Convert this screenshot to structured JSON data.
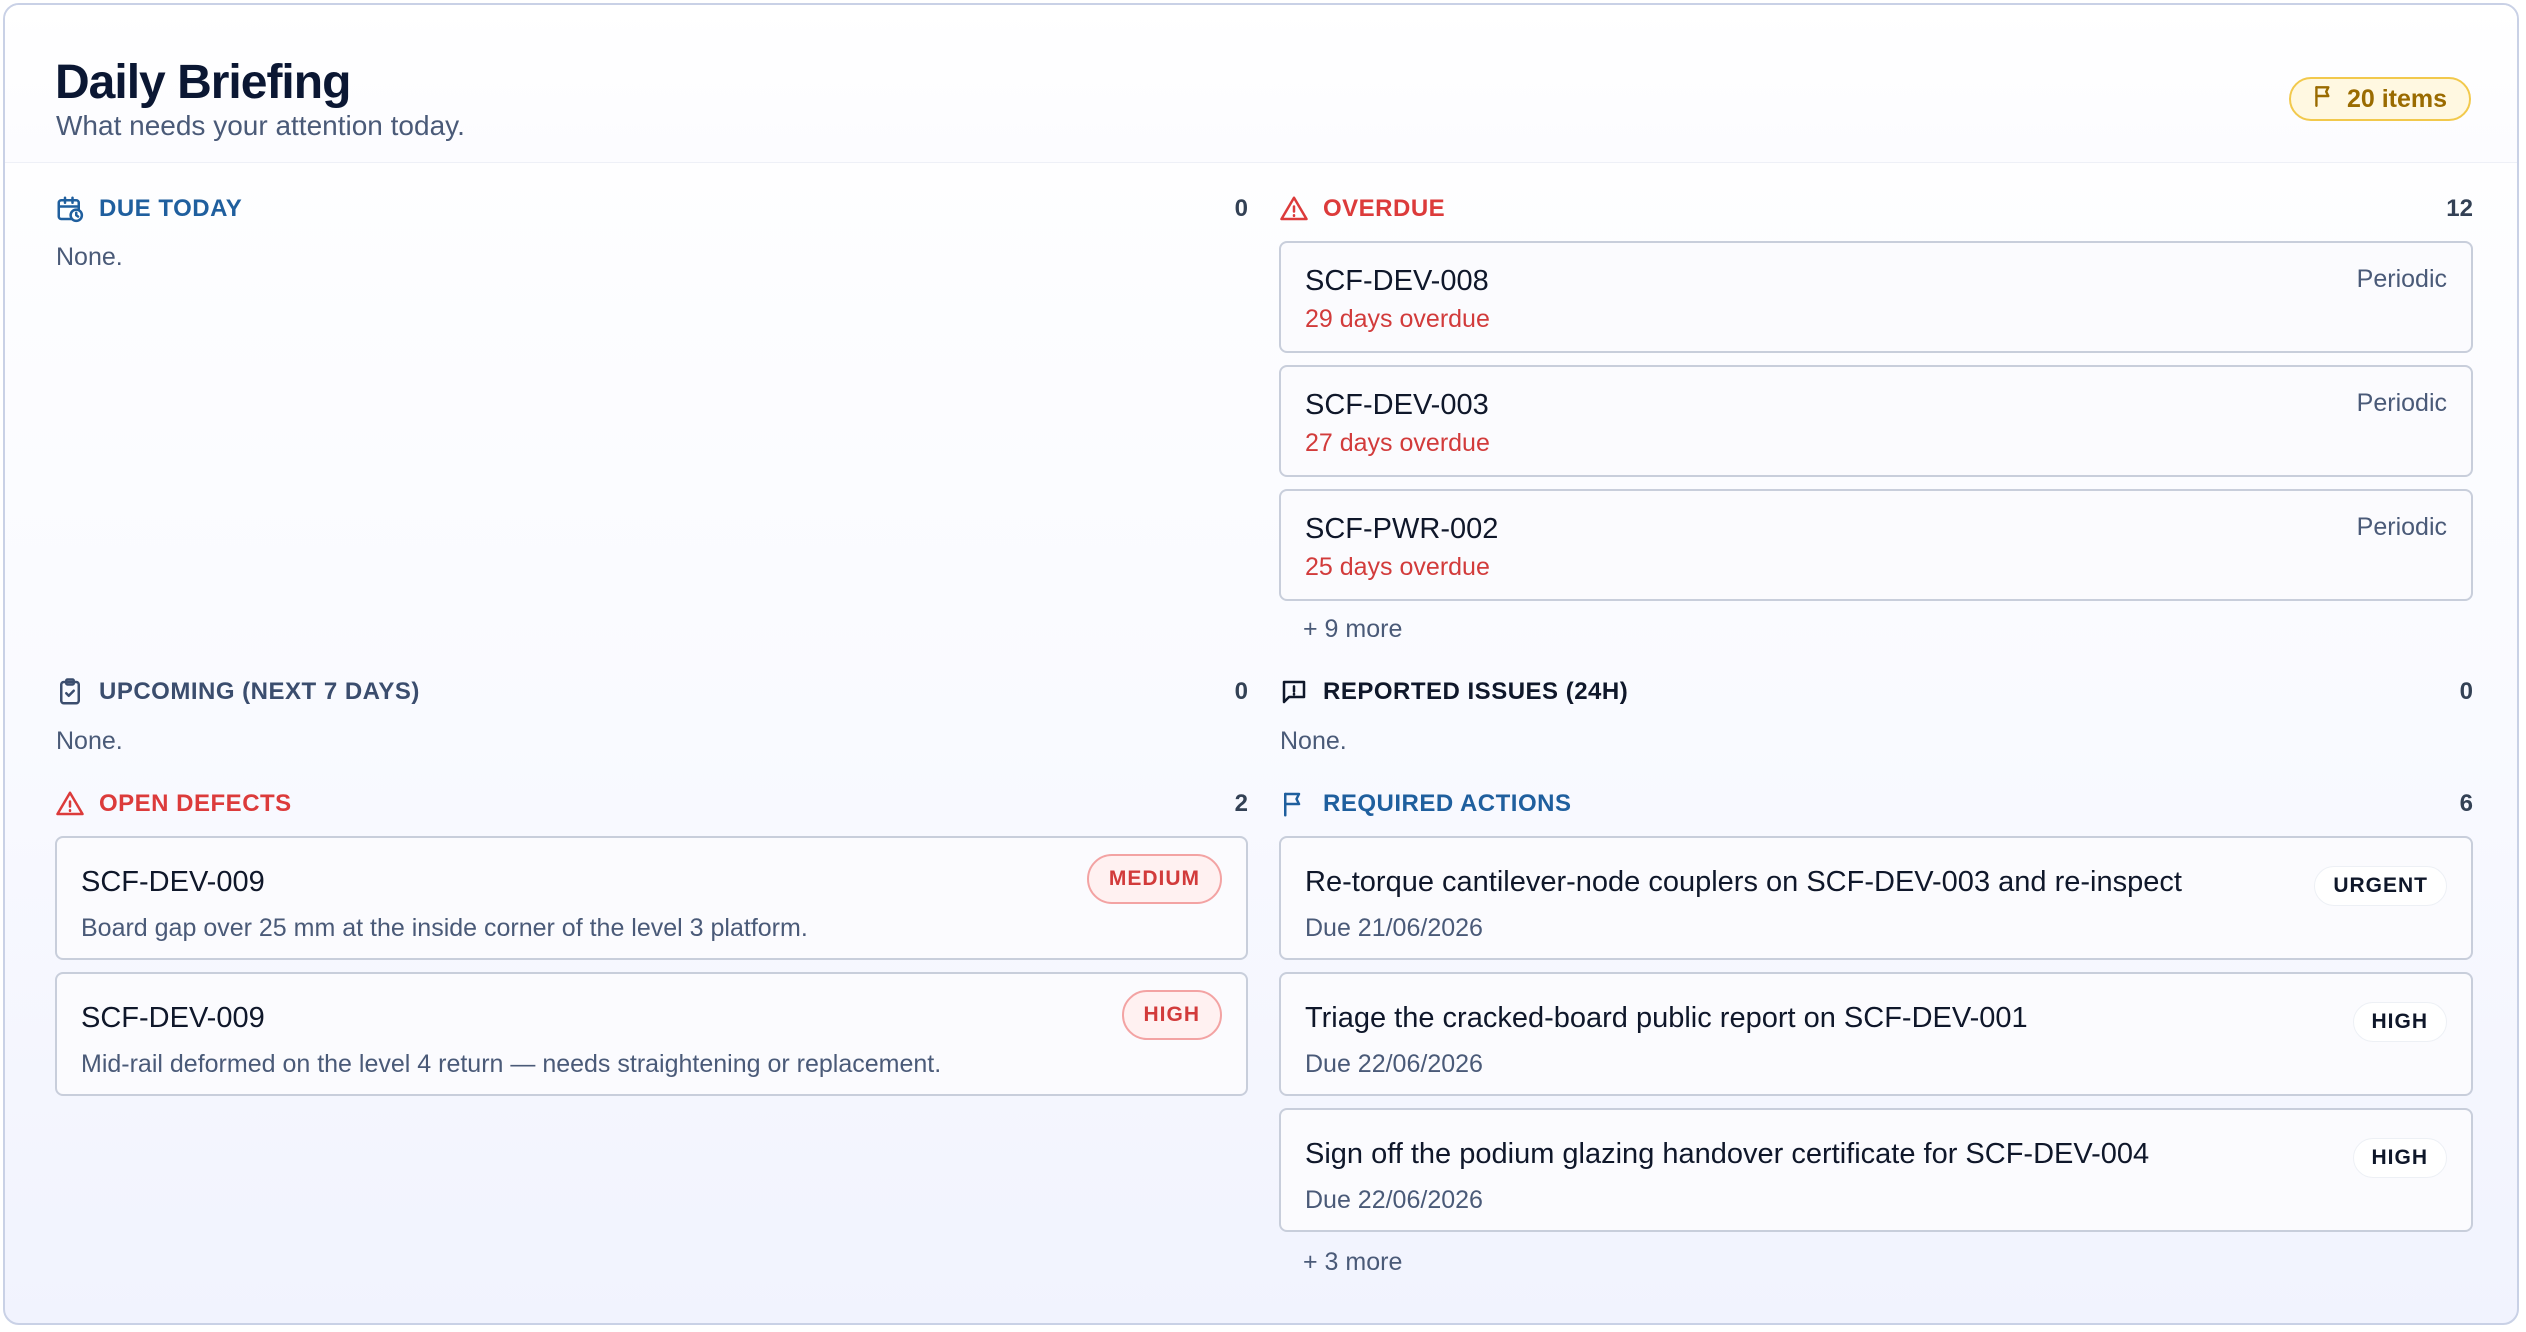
{
  "header": {
    "title": "Daily Briefing",
    "subtitle": "What needs your attention today.",
    "badge": "20 items"
  },
  "due_today": {
    "label": "DUE TODAY",
    "count": "0",
    "empty": "None."
  },
  "overdue": {
    "label": "OVERDUE",
    "count": "12",
    "items": [
      {
        "code": "SCF-DEV-008",
        "status": "29 days overdue",
        "type": "Periodic"
      },
      {
        "code": "SCF-DEV-003",
        "status": "27 days overdue",
        "type": "Periodic"
      },
      {
        "code": "SCF-PWR-002",
        "status": "25 days overdue",
        "type": "Periodic"
      }
    ],
    "more": "+ 9 more"
  },
  "upcoming": {
    "label": "UPCOMING (NEXT 7 DAYS)",
    "count": "0",
    "empty": "None."
  },
  "reported": {
    "label": "REPORTED ISSUES (24H)",
    "count": "0",
    "empty": "None."
  },
  "defects": {
    "label": "OPEN DEFECTS",
    "count": "2",
    "items": [
      {
        "code": "SCF-DEV-009",
        "severity": "MEDIUM",
        "desc": "Board gap over 25 mm at the inside corner of the level 3 platform."
      },
      {
        "code": "SCF-DEV-009",
        "severity": "HIGH",
        "desc": "Mid-rail deformed on the level 4 return — needs straightening or replacement."
      }
    ]
  },
  "actions": {
    "label": "REQUIRED ACTIONS",
    "count": "6",
    "items": [
      {
        "title": "Re-torque cantilever-node couplers on SCF-DEV-003 and re-inspect",
        "due": "Due 21/06/2026",
        "priority": "URGENT"
      },
      {
        "title": "Triage the cracked-board public report on SCF-DEV-001",
        "due": "Due 22/06/2026",
        "priority": "HIGH"
      },
      {
        "title": "Sign off the podium glazing handover certificate for SCF-DEV-004",
        "due": "Due 22/06/2026",
        "priority": "HIGH"
      }
    ],
    "more": "+ 3 more"
  },
  "colors": {
    "accent_blue": "#1f5f9e",
    "alert_red": "#dc3b3b",
    "badge_amber": "#f2c94c"
  },
  "icons": [
    "flag-icon",
    "calendar-clock-icon",
    "warning-triangle-icon",
    "clipboard-check-icon",
    "message-alert-icon"
  ]
}
